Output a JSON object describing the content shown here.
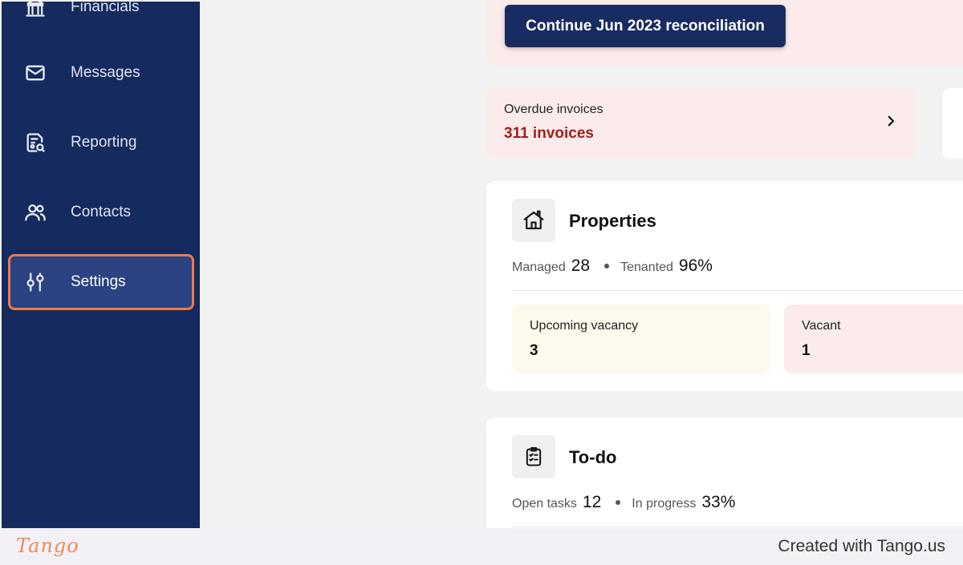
{
  "sidebar": {
    "items": [
      {
        "label": "Financials",
        "icon": "bank-icon"
      },
      {
        "label": "Messages",
        "icon": "mail-icon"
      },
      {
        "label": "Reporting",
        "icon": "report-search-icon"
      },
      {
        "label": "Contacts",
        "icon": "users-icon"
      },
      {
        "label": "Settings",
        "icon": "sliders-icon",
        "active": true
      }
    ]
  },
  "banner": {
    "button_label": "Continue Jun 2023 reconciliation"
  },
  "overdue": {
    "label": "Overdue invoices",
    "value": "311 invoices"
  },
  "properties": {
    "title": "Properties",
    "managed_label": "Managed",
    "managed_value": "28",
    "tenanted_label": "Tenanted",
    "tenanted_value": "96%",
    "tiles": [
      {
        "label": "Upcoming vacancy",
        "value": "3",
        "color": "#fdf9ec"
      },
      {
        "label": "Vacant",
        "value": "1",
        "color": "#fbeceb"
      }
    ]
  },
  "todo": {
    "title": "To-do",
    "open_label": "Open tasks",
    "open_value": "12",
    "progress_label": "In progress",
    "progress_value": "33%"
  },
  "footer": {
    "logo": "Tango",
    "text": "Created with Tango.us"
  },
  "colors": {
    "sidebar": "#152a5e",
    "accent": "#ee7a46",
    "danger": "#a51d1d"
  }
}
